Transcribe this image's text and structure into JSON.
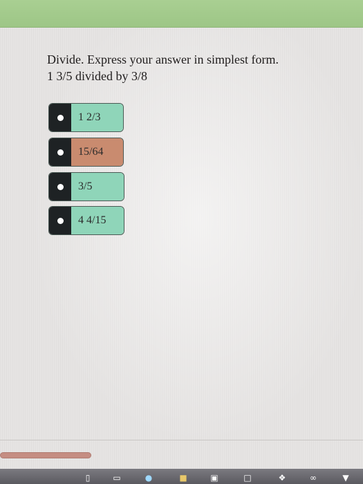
{
  "question": {
    "instruction": "Divide. Express your answer in simplest form.",
    "problem": "1 3/5 divided by 3/8"
  },
  "answers": [
    {
      "label": "1 2/3",
      "color": "#8fd5b9"
    },
    {
      "label": "15/64",
      "color": "#c98b6f"
    },
    {
      "label": "3/5",
      "color": "#8fd5b9"
    },
    {
      "label": "4 4/15",
      "color": "#8fd5b9"
    }
  ],
  "progress": {
    "fraction": 0.25,
    "color": "#c58d82"
  },
  "taskbar": {
    "icons": [
      "explorer-icon",
      "edge-icon",
      "folder-icon",
      "store-icon",
      "amazon-icon",
      "dropbox-icon",
      "infinity-icon",
      "app-icon"
    ]
  },
  "colors": {
    "header": "#a9cf92",
    "bullet_bg": "#1e2224",
    "correct_highlight": "#8fd5b9",
    "selected_highlight": "#c98b6f"
  }
}
